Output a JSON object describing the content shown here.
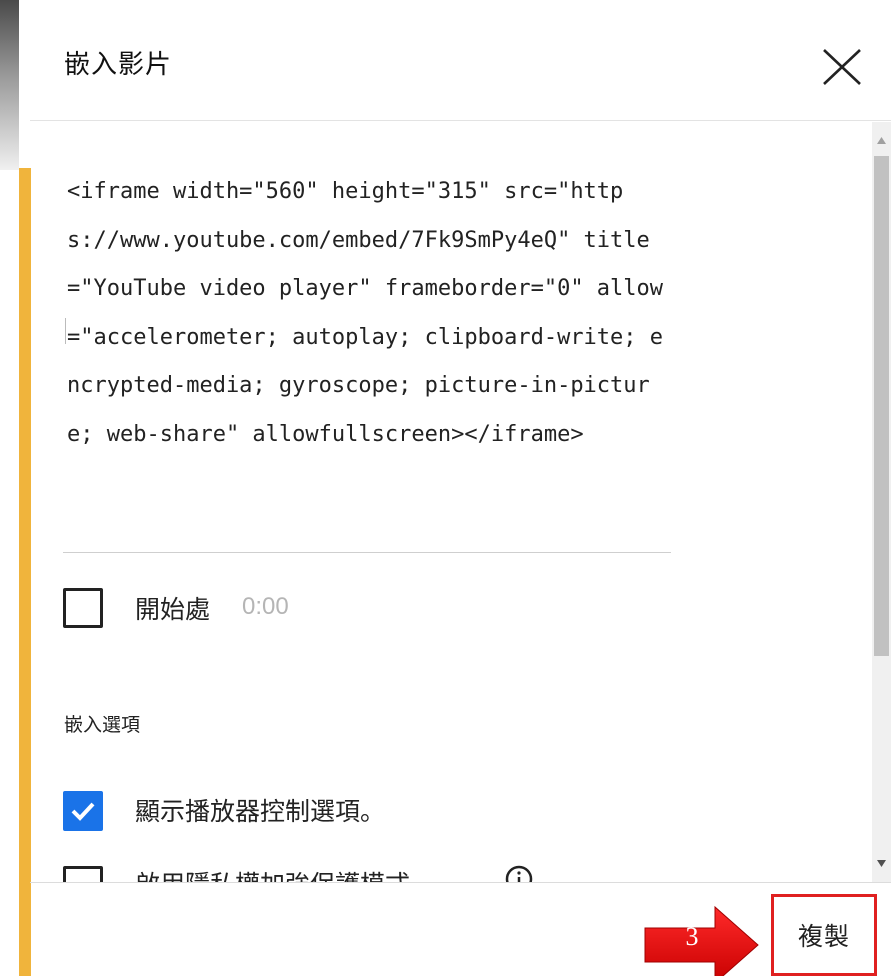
{
  "dialog": {
    "title": "嵌入影片",
    "close_icon": "close-icon"
  },
  "embed_code": "<iframe width=\"560\" height=\"315\" src=\"https://www.youtube.com/embed/7Fk9SmPy4eQ\" title=\"YouTube video player\" frameborder=\"0\" allow=\"accelerometer; autoplay; clipboard-write; encrypted-media; gyroscope; picture-in-picture; web-share\" allowfullscreen></iframe>",
  "start_at": {
    "label": "開始處",
    "time": "0:00",
    "checked": false
  },
  "embed_options": {
    "section_label": "嵌入選項",
    "options": [
      {
        "label": "顯示播放器控制選項。",
        "checked": true
      },
      {
        "label": "啟用隱私權加強保護模式。",
        "checked": false,
        "has_info_icon": true
      }
    ]
  },
  "footer": {
    "copy_label": "複製",
    "annotation_number": "3"
  },
  "colors": {
    "accent_blue": "#1a73e8",
    "annotation_red": "#e02020",
    "edge_orange": "#f0b43c"
  }
}
